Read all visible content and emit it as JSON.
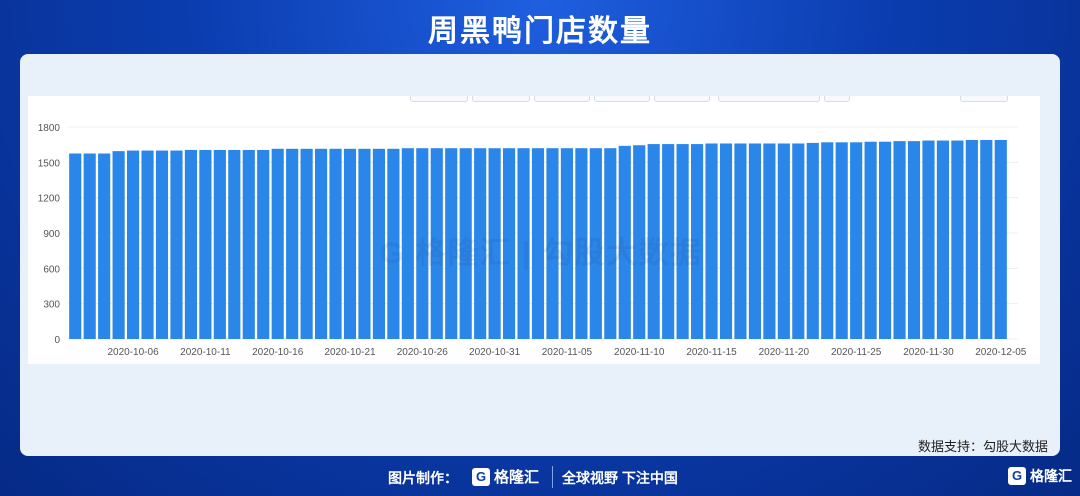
{
  "header": {
    "title": "周黑鸭门店数量"
  },
  "chart_data": {
    "type": "bar",
    "title": "周黑鸭门店数量",
    "xlabel": "",
    "ylabel": "",
    "ylim": [
      0,
      1800
    ],
    "yticks": [
      0,
      300,
      600,
      900,
      1200,
      1500,
      1800
    ],
    "grid": true,
    "categories": [
      "2020-10-02",
      "2020-10-03",
      "2020-10-04",
      "2020-10-05",
      "2020-10-06",
      "2020-10-07",
      "2020-10-08",
      "2020-10-09",
      "2020-10-10",
      "2020-10-11",
      "2020-10-12",
      "2020-10-13",
      "2020-10-14",
      "2020-10-15",
      "2020-10-16",
      "2020-10-17",
      "2020-10-18",
      "2020-10-19",
      "2020-10-20",
      "2020-10-21",
      "2020-10-22",
      "2020-10-23",
      "2020-10-24",
      "2020-10-25",
      "2020-10-26",
      "2020-10-27",
      "2020-10-28",
      "2020-10-29",
      "2020-10-30",
      "2020-10-31",
      "2020-11-01",
      "2020-11-02",
      "2020-11-03",
      "2020-11-04",
      "2020-11-05",
      "2020-11-06",
      "2020-11-07",
      "2020-11-08",
      "2020-11-09",
      "2020-11-10",
      "2020-11-11",
      "2020-11-12",
      "2020-11-13",
      "2020-11-14",
      "2020-11-15",
      "2020-11-16",
      "2020-11-17",
      "2020-11-18",
      "2020-11-19",
      "2020-11-20",
      "2020-11-21",
      "2020-11-22",
      "2020-11-23",
      "2020-11-24",
      "2020-11-25",
      "2020-11-26",
      "2020-11-27",
      "2020-11-28",
      "2020-11-29",
      "2020-11-30",
      "2020-12-01",
      "2020-12-02",
      "2020-12-03",
      "2020-12-04",
      "2020-12-05"
    ],
    "xtick_labels": [
      "2020-10-06",
      "2020-10-11",
      "2020-10-16",
      "2020-10-21",
      "2020-10-26",
      "2020-10-31",
      "2020-11-05",
      "2020-11-10",
      "2020-11-15",
      "2020-11-20",
      "2020-11-25",
      "2020-11-30",
      "2020-12-05"
    ],
    "values": [
      1575,
      1575,
      1575,
      1595,
      1600,
      1600,
      1600,
      1600,
      1605,
      1605,
      1605,
      1605,
      1605,
      1605,
      1615,
      1615,
      1615,
      1615,
      1615,
      1615,
      1615,
      1615,
      1615,
      1620,
      1620,
      1620,
      1620,
      1620,
      1620,
      1620,
      1620,
      1620,
      1620,
      1620,
      1620,
      1620,
      1620,
      1620,
      1640,
      1645,
      1655,
      1655,
      1655,
      1655,
      1660,
      1660,
      1660,
      1660,
      1660,
      1660,
      1660,
      1665,
      1670,
      1670,
      1670,
      1675,
      1675,
      1680,
      1680,
      1685,
      1685,
      1685,
      1690,
      1690,
      1690
    ],
    "color": "#2a86e8"
  },
  "source_label": "数据支持：勾股大数据",
  "footer": {
    "credit": "图片制作：",
    "brand_mark": "G",
    "brand_name": "格隆汇",
    "slogan": "全球视野 下注中国"
  },
  "watermark": "G 格隆汇 | 勾股大数据"
}
